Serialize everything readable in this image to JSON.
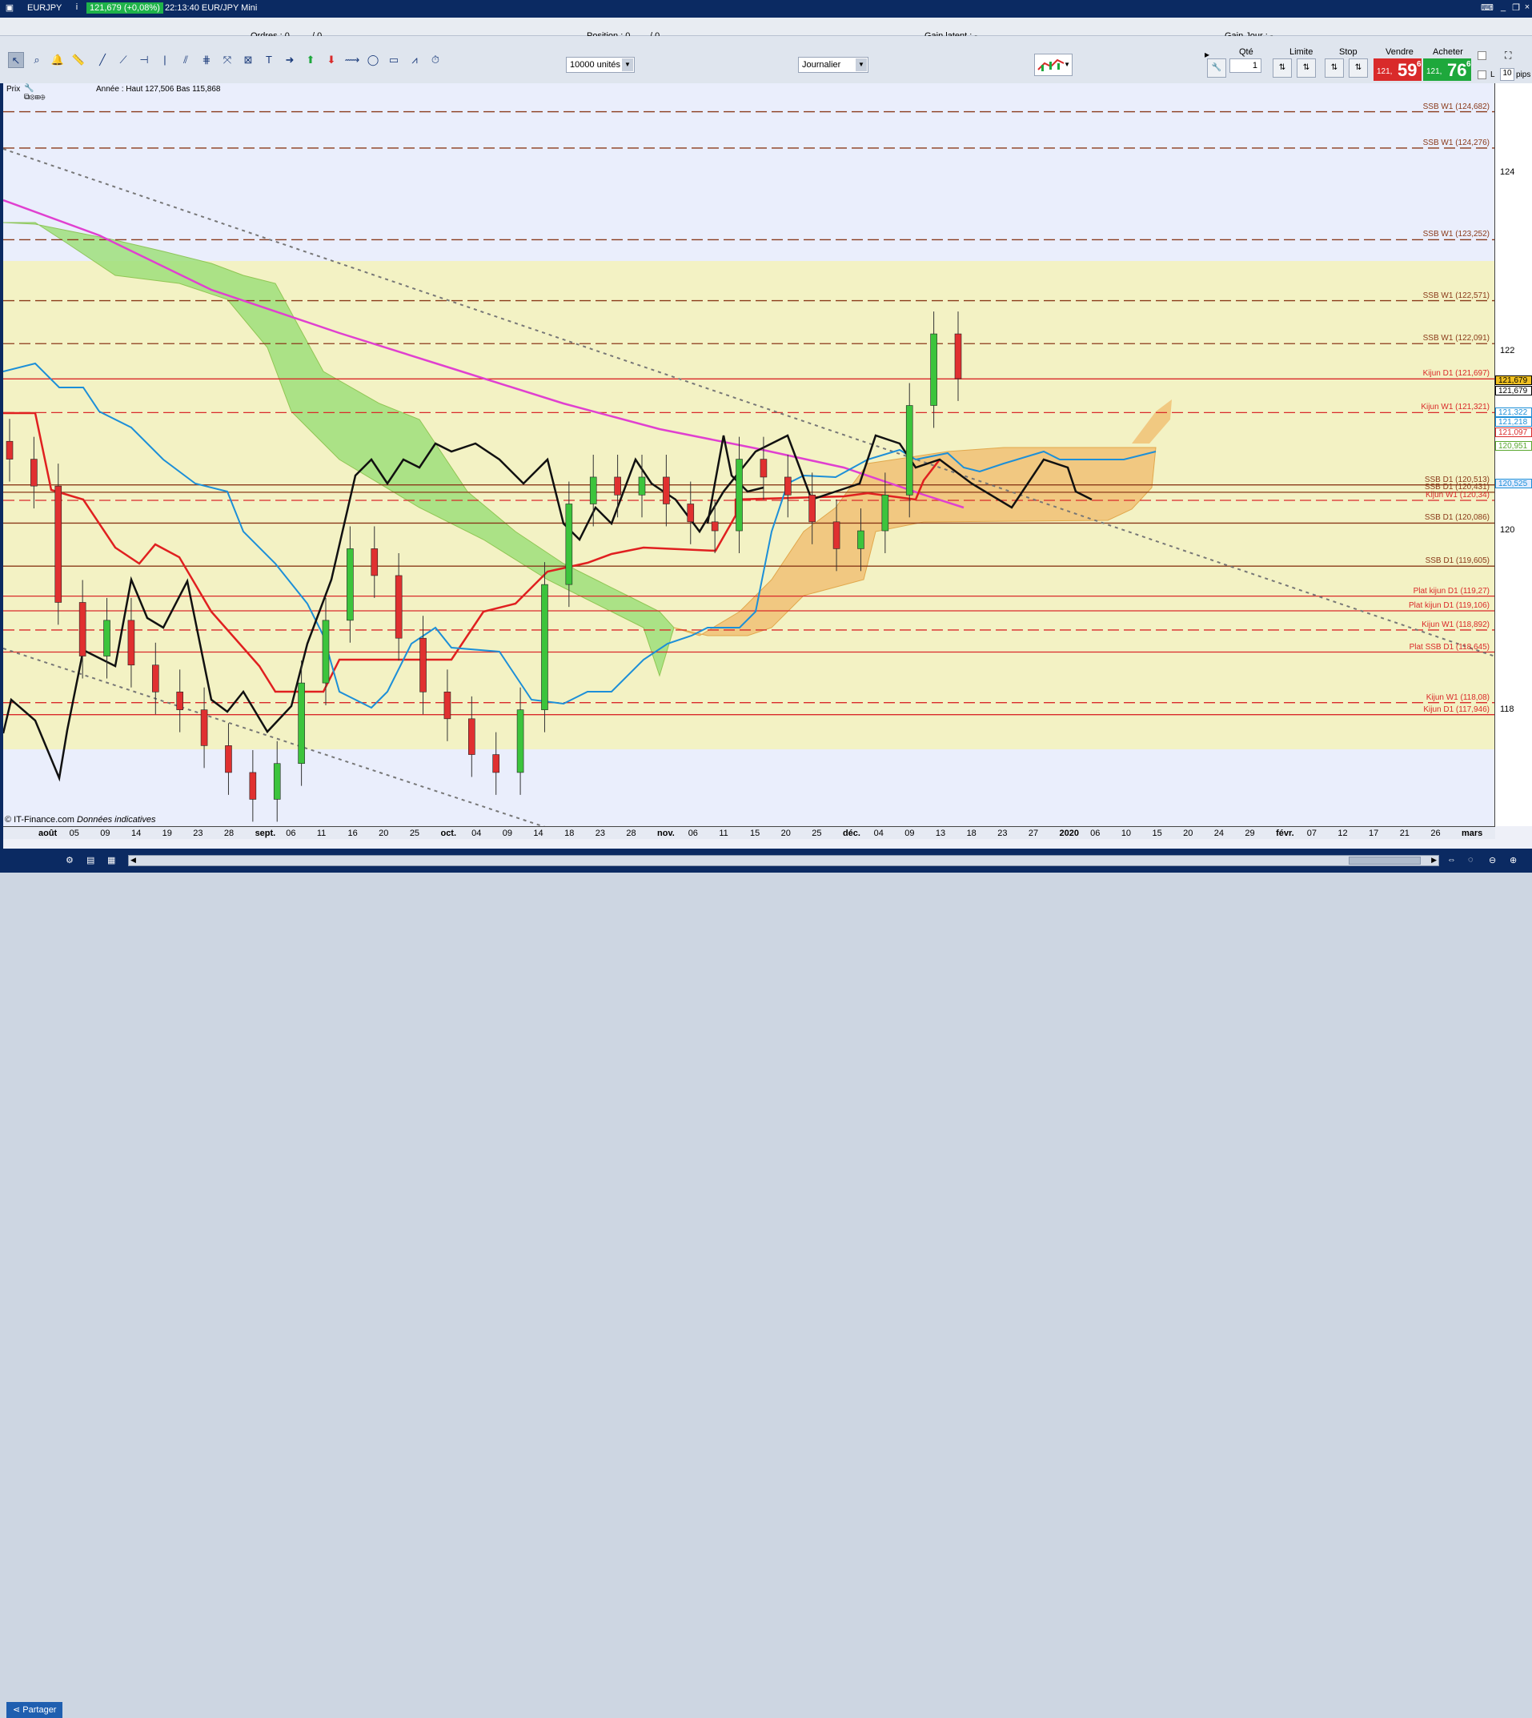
{
  "window": {
    "symbol": "EURJPY",
    "quote_badge": "121,679 (+0,08%)",
    "title": "22:13:40 EUR/JPY Mini"
  },
  "order_bar": {
    "orders": "Ordres : 0",
    "orders_sep": "/ 0",
    "position": "Position : 0",
    "position_sep": "/ 0",
    "gain_latent": "Gain latent : -",
    "gain_jour": "Gain Jour : -"
  },
  "toolbar": {
    "units_select": "10000 unités",
    "period_select": "Journalier"
  },
  "trade_panel": {
    "qty_label": "Qté",
    "limit_label": "Limite",
    "stop_label": "Stop",
    "sell_label": "Vendre",
    "buy_label": "Acheter",
    "qty_value": "1",
    "sell_small": "121,",
    "sell_big": "59",
    "sell_sup": "6",
    "buy_small": "121,",
    "buy_big": "76",
    "buy_sup": "6",
    "check_l": "L",
    "pips_value": "10",
    "pips_label": "pips",
    "sell_color": "#d92a2a",
    "buy_color": "#1ea83c"
  },
  "chart_info": {
    "prix_label": "Prix",
    "annee": "Année : Haut 127,506  Bas 115,868"
  },
  "chart_data": {
    "type": "candlestick",
    "symbol": "EUR/JPY",
    "period": "Journalier",
    "ylim": [
      116.7,
      125.0
    ],
    "y_ticks": [
      "124",
      "122",
      "120",
      "118"
    ],
    "x_ticks": [
      "août",
      "05",
      "09",
      "14",
      "19",
      "23",
      "28",
      "sept.",
      "06",
      "11",
      "16",
      "20",
      "25",
      "oct.",
      "04",
      "09",
      "14",
      "18",
      "23",
      "28",
      "nov.",
      "06",
      "11",
      "15",
      "20",
      "25",
      "déc.",
      "04",
      "09",
      "13",
      "18",
      "23",
      "27",
      "2020",
      "06",
      "10",
      "15",
      "20",
      "24",
      "29",
      "févr.",
      "07",
      "12",
      "17",
      "21",
      "26",
      "mars"
    ],
    "horizontal_levels": [
      {
        "label": "SSB W1 (124,682)",
        "value": 124.682,
        "color": "#8a3a1a",
        "style": "dash"
      },
      {
        "label": "SSB W1 (124,276)",
        "value": 124.276,
        "color": "#8a3a1a",
        "style": "dash"
      },
      {
        "label": "SSB W1 (123,252)",
        "value": 123.252,
        "color": "#8a3a1a",
        "style": "dash"
      },
      {
        "label": "SSB W1 (122,571)",
        "value": 122.571,
        "color": "#8a3a1a",
        "style": "dash"
      },
      {
        "label": "SSB W1 (122,091)",
        "value": 122.091,
        "color": "#8a3a1a",
        "style": "dash"
      },
      {
        "label": "Kijun D1 (121,697)",
        "value": 121.697,
        "color": "#d92a2a",
        "style": "solid"
      },
      {
        "label": "Kijun W1 (121,321)",
        "value": 121.321,
        "color": "#d92a2a",
        "style": "dash"
      },
      {
        "label": "SSB D1 (120,513)",
        "value": 120.513,
        "color": "#8a3a1a",
        "style": "solid"
      },
      {
        "label": "SSB D1 (120,431)",
        "value": 120.431,
        "color": "#8a3a1a",
        "style": "solid"
      },
      {
        "label": "Kijun W1 (120,34)",
        "value": 120.34,
        "color": "#d92a2a",
        "style": "dash"
      },
      {
        "label": "SSB D1 (120,086)",
        "value": 120.086,
        "color": "#8a3a1a",
        "style": "solid"
      },
      {
        "label": "SSB D1 (119,605)",
        "value": 119.605,
        "color": "#8a3a1a",
        "style": "solid"
      },
      {
        "label": "Plat kijun D1 (119,27)",
        "value": 119.27,
        "color": "#d92a2a",
        "style": "solid"
      },
      {
        "label": "Plat kijun D1 (119,106)",
        "value": 119.106,
        "color": "#d92a2a",
        "style": "solid"
      },
      {
        "label": "Kijun W1 (118,892)",
        "value": 118.892,
        "color": "#d92a2a",
        "style": "dash"
      },
      {
        "label": "Plat SSB D1 (118,645)",
        "value": 118.645,
        "color": "#d92a2a",
        "style": "solid"
      },
      {
        "label": "Kijun W1 (118,08)",
        "value": 118.08,
        "color": "#d92a2a",
        "style": "dash"
      },
      {
        "label": "Kijun D1 (117,946)",
        "value": 117.946,
        "color": "#d92a2a",
        "style": "solid"
      }
    ],
    "price_tags": [
      {
        "text": "121,679",
        "value": 121.679,
        "color": "#000000",
        "bg": "#f0c020"
      },
      {
        "text": "121,679",
        "value": 121.679,
        "color": "#000000",
        "bg": "#ffffff"
      },
      {
        "text": "121,322",
        "value": 121.322,
        "color": "#1c8fd8",
        "bg": "#ffffff"
      },
      {
        "text": "121,218",
        "value": 121.218,
        "color": "#1c8fd8",
        "bg": "#ffffff"
      },
      {
        "text": "121,097",
        "value": 121.097,
        "color": "#d92a2a",
        "bg": "#ffffff"
      },
      {
        "text": "120,951",
        "value": 120.951,
        "color": "#5aa830",
        "bg": "#ffffff"
      },
      {
        "text": "120,525",
        "value": 120.525,
        "color": "#1c8fd8",
        "bg": "#e0ecff"
      }
    ],
    "candles_close_sample": [
      120.8,
      120.5,
      119.2,
      118.6,
      119.0,
      118.5,
      118.2,
      118.0,
      117.6,
      117.3,
      117.0,
      117.4,
      118.3,
      119.0,
      119.8,
      119.5,
      118.8,
      118.2,
      117.9,
      117.5,
      117.3,
      118.0,
      119.4,
      120.3,
      120.6,
      120.4,
      120.6,
      120.3,
      120.1,
      120.0,
      120.8,
      120.6,
      120.4,
      120.1,
      119.8,
      120.0,
      120.4,
      121.4,
      122.2,
      121.7
    ]
  },
  "footer": {
    "copyright": "© IT-Finance.com",
    "indicative": "Données indicatives",
    "share_button": "Partager"
  }
}
